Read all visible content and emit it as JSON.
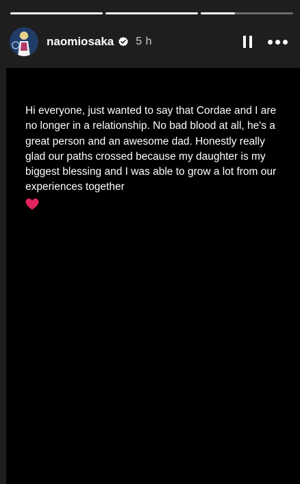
{
  "progress": [
    {
      "fill": 1.0
    },
    {
      "fill": 1.0
    },
    {
      "fill": 0.37
    }
  ],
  "header": {
    "username": "naomiosaka",
    "time": "5 h"
  },
  "icons": {
    "verified": "verified-badge-icon",
    "pause": "pause-icon",
    "more": "more-options-icon",
    "heart": "red-heart-emoji"
  },
  "story": {
    "text": "Hi everyone, just wanted to say that Cordae and I are no longer in a relationship. No bad blood at all, he's a great person and an awesome dad. Honestly really glad our paths crossed because my daughter is my biggest blessing and I was able to grow a lot from our experiences together",
    "heart_color": "#e0245e"
  }
}
